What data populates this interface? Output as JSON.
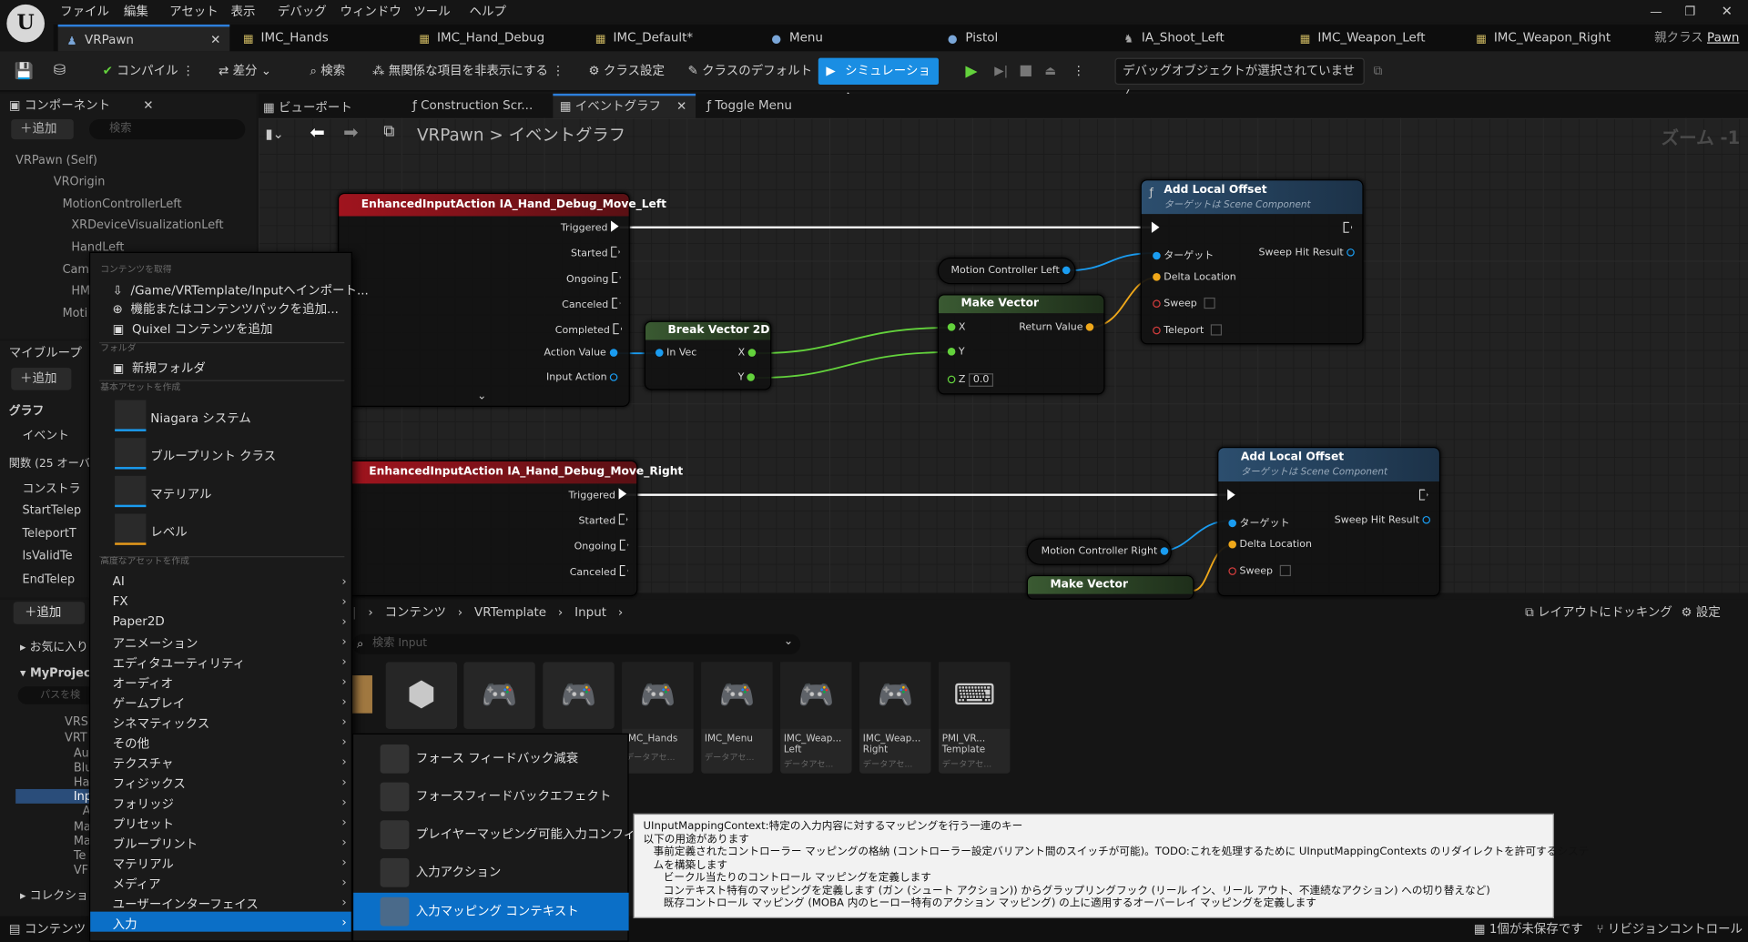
{
  "menubar": {
    "items": [
      "ファイル",
      "編集",
      "アセット",
      "表示",
      "デバッグ",
      "ウィンドウ",
      "ツール",
      "ヘルプ"
    ]
  },
  "tabs": [
    {
      "label": "VRPawn",
      "active": true
    },
    {
      "label": "IMC_Hands"
    },
    {
      "label": "IMC_Hand_Debug"
    },
    {
      "label": "IMC_Default*"
    },
    {
      "label": "Menu"
    },
    {
      "label": "Pistol"
    },
    {
      "label": "IA_Shoot_Left"
    },
    {
      "label": "IMC_Weapon_Left"
    },
    {
      "label": "IMC_Weapon_Right"
    }
  ],
  "parent_class": {
    "label": "親クラス",
    "value": "Pawn"
  },
  "toolbar": {
    "compile": "コンパイル",
    "diff": "差分",
    "search": "検索",
    "hide_unrelated": "無関係な項目を非表示にする",
    "class_settings": "クラス設定",
    "class_defaults": "クラスのデフォルト",
    "simulation": "シミュレーション",
    "debug_select": "デバッグオブジェクトが選択されていません"
  },
  "components": {
    "title": "コンポーネント",
    "add": "追加",
    "search_placeholder": "検索",
    "tree": [
      "VRPawn (Self)",
      "VROrigin",
      "MotionControllerLeft",
      "XRDeviceVisualizationLeft",
      "HandLeft",
      "Cam",
      "HM",
      "Moti"
    ]
  },
  "editor_tabs": [
    "ビューポート",
    "Construction Scr...",
    "イベントグラフ",
    "Toggle Menu"
  ],
  "breadcrumb": {
    "root": "VRPawn",
    "sep": ">",
    "current": "イベントグラフ",
    "zoom": "ズーム -1"
  },
  "mybp": {
    "title": "マイブループ",
    "add": "追加",
    "graph": "グラフ",
    "events": "イベント",
    "functions": "関数 (25 オーバ",
    "items": [
      "コンストラ",
      "StartTelep",
      "TeleportT",
      "IsValidTe",
      "EndTelep"
    ]
  },
  "nodes": {
    "left_event": {
      "title": "EnhancedInputAction IA_Hand_Debug_Move_Left",
      "pins": [
        "Triggered",
        "Started",
        "Ongoing",
        "Canceled",
        "Completed",
        "Action Value",
        "Input Action"
      ]
    },
    "break_vec": {
      "title": "Break Vector 2D",
      "in": "In Vec",
      "x": "X",
      "y": "Y"
    },
    "mc_left": {
      "label": "Motion Controller Left"
    },
    "make_vec": {
      "title": "Make Vector",
      "x": "X",
      "y": "Y",
      "z": "Z",
      "z_val": "0.0",
      "ret": "Return Value"
    },
    "add_offset_1": {
      "title": "Add Local Offset",
      "subtitle": "ターゲットは Scene Component",
      "target": "ターゲット",
      "delta": "Delta Location",
      "sweep": "Sweep",
      "teleport": "Teleport",
      "result": "Sweep Hit Result"
    },
    "right_event": {
      "title": "EnhancedInputAction IA_Hand_Debug_Move_Right",
      "pins": [
        "Triggered",
        "Started",
        "Ongoing",
        "Canceled"
      ]
    },
    "mc_right": {
      "label": "Motion Controller Right"
    },
    "make_vec2": {
      "title": "Make Vector"
    },
    "add_offset_2": {
      "title": "Add Local Offset",
      "subtitle": "ターゲットは Scene Component",
      "target": "ターゲット",
      "delta": "Delta Location",
      "sweep": "Sweep",
      "result": "Sweep Hit Result"
    }
  },
  "context_menu": {
    "get_content": "コンテンツを取得",
    "import": "/Game/VRTemplate/Inputへインポート...",
    "add_feature": "機能またはコンテンツパックを追加...",
    "quixel": "Quixel コンテンツを追加",
    "folder_sec": "フォルダ",
    "new_folder": "新規フォルダ",
    "basic_sec": "基本アセットを作成",
    "basic": [
      "Niagara システム",
      "ブループリント クラス",
      "マテリアル",
      "レベル"
    ],
    "adv_sec": "高度なアセットを作成",
    "categories": [
      "AI",
      "FX",
      "Paper2D",
      "アニメーション",
      "エディタユーティリティ",
      "オーディオ",
      "ゲームプレイ",
      "シネマティックス",
      "その他",
      "テクスチャ",
      "フィジックス",
      "フォリッジ",
      "プリセット",
      "ブループリント",
      "マテリアル",
      "メディア",
      "ユーザーインターフェイス",
      "入力"
    ]
  },
  "submenu": [
    "フォース フィードバック減衰",
    "フォースフィードバックエフェクト",
    "プレイヤーマッピング可能入力コンフィグ",
    "入力アクション",
    "入力マッピング コンテキスト"
  ],
  "tooltip": [
    "UInputMappingContext:特定の入力内容に対するマッピングを行う一連のキー",
    "以下の用途があります",
    "   事前定義されたコントローラー マッピングの格納 (コントローラー設定バリアント間のスイッチが可能)。TODO:これを処理するために UInputMappingContexts のリダイレクトを許可するシステ",
    "   ムを構築します",
    "      ビークル当たりのコントロール マッピングを定義します",
    "      コンテキスト特有のマッピングを定義します (ガン (シュート アクション)) からグラップリングフック (リール イン、リール アウト、不連続なアクション) への切り替えなど)",
    "      既存コントロール マッピング (MOBA 内のヒーロー特有のアクション マッピング) の上に適用するオーバーレイ マッピングを定義します"
  ],
  "content_browser": {
    "path": [
      "コンテンツ",
      "VRTemplate",
      "Input"
    ],
    "dock": "レイアウトにドッキング",
    "settings": "設定",
    "search_placeholder": "検索 Input",
    "add": "追加",
    "favorites": "お気に入り",
    "project": "MyProject",
    "path_search": "パスを検",
    "collections": "コレクショ",
    "folder_tree": [
      "VRS",
      "VRT",
      "Au",
      "Blu",
      "Ha",
      "Inp",
      "A",
      "Ma",
      "Ma",
      "Te",
      "VF"
    ],
    "assets": [
      {
        "name": "IMC_Hands",
        "type": "データアセ..."
      },
      {
        "name": "IMC_Menu",
        "type": "データアセ..."
      },
      {
        "name": "IMC_Weap... Left",
        "type": "データアセ..."
      },
      {
        "name": "IMC_Weap... Right",
        "type": "データアセ..."
      },
      {
        "name": "PMI_VR... Template",
        "type": "データアセ..."
      }
    ]
  },
  "status": {
    "content_drawer": "コンテンツ",
    "unsaved": "1個が未保存です",
    "revision": "リビジョンコントロール"
  }
}
